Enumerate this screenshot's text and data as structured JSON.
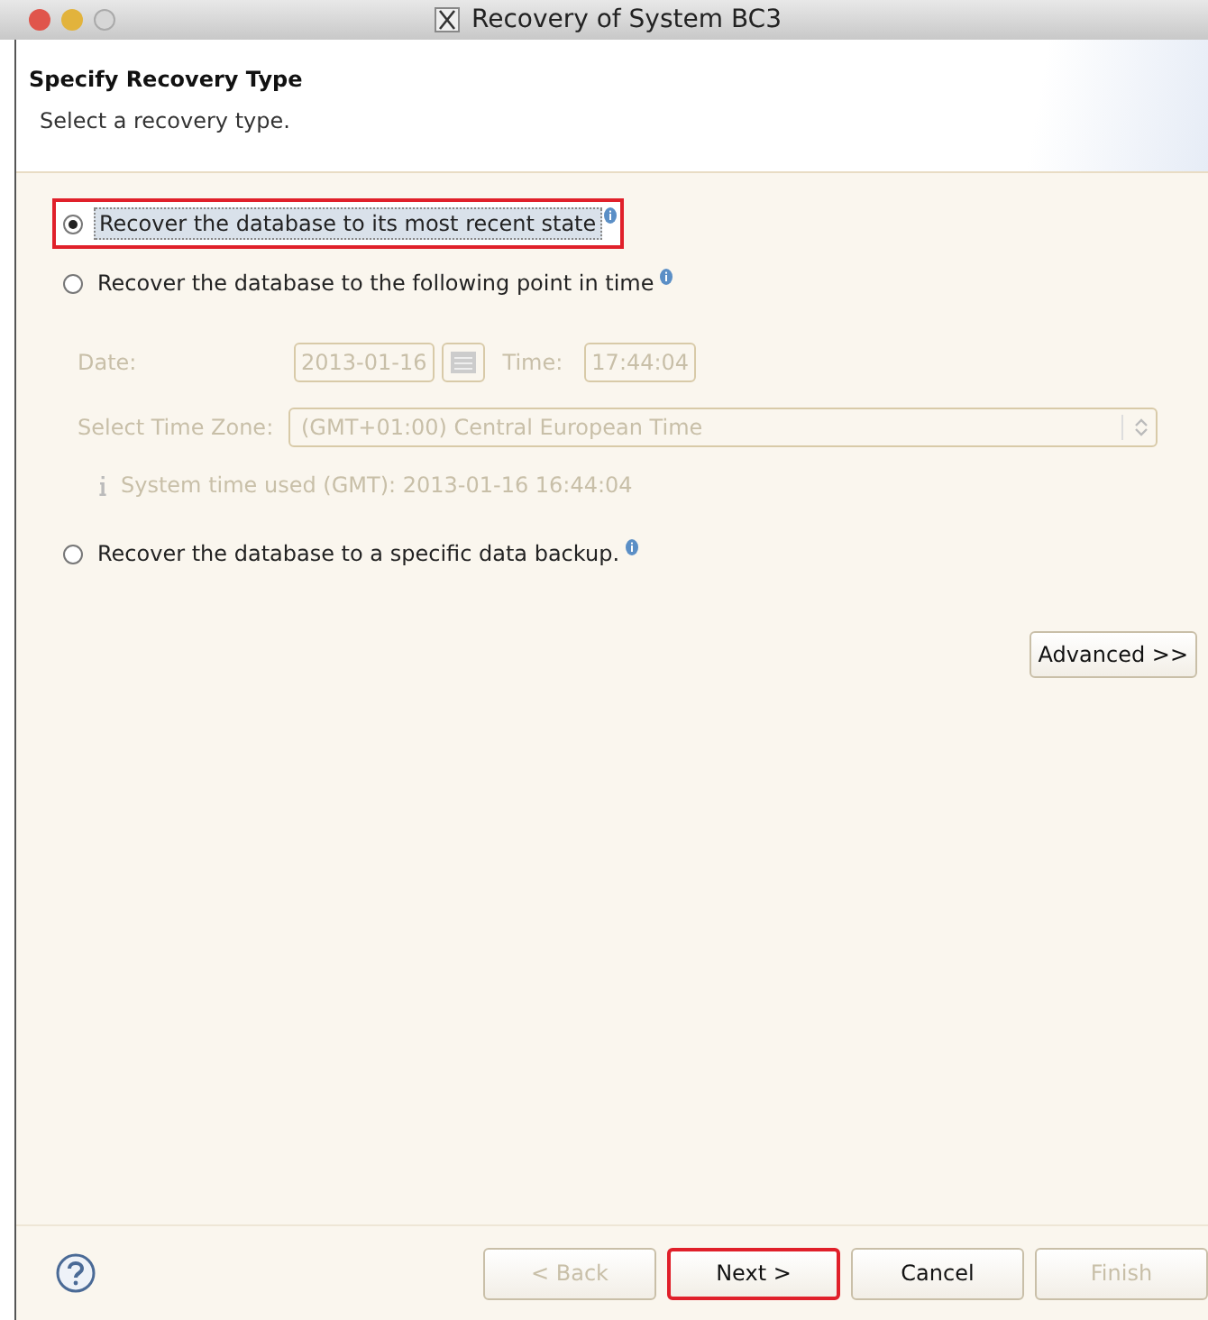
{
  "window": {
    "title": "Recovery of System BC3"
  },
  "header": {
    "title": "Specify Recovery Type",
    "subtitle": "Select a recovery type."
  },
  "options": [
    {
      "label": "Recover the database to its most recent state",
      "selected": true,
      "highlighted": true
    },
    {
      "label": "Recover the database to the following point in time",
      "selected": false,
      "highlighted": false
    },
    {
      "label": "Recover the database to a specific data backup.",
      "selected": false,
      "highlighted": false
    }
  ],
  "point_in_time": {
    "disabled": true,
    "date_label": "Date:",
    "date": "2013-01-16",
    "time_label": "Time:",
    "time": "17:44:04",
    "timezone_label": "Select Time Zone:",
    "timezone": "(GMT+01:00) Central European Time",
    "note": "System time used (GMT): 2013-01-16 16:44:04"
  },
  "advanced_button": {
    "label": "Advanced >>"
  },
  "buttons": [
    {
      "label": "< Back",
      "disabled": true,
      "highlighted": false
    },
    {
      "label": "Next >",
      "disabled": false,
      "highlighted": true
    },
    {
      "label": "Cancel",
      "disabled": false,
      "highlighted": false
    },
    {
      "label": "Finish",
      "disabled": true,
      "highlighted": false
    }
  ]
}
